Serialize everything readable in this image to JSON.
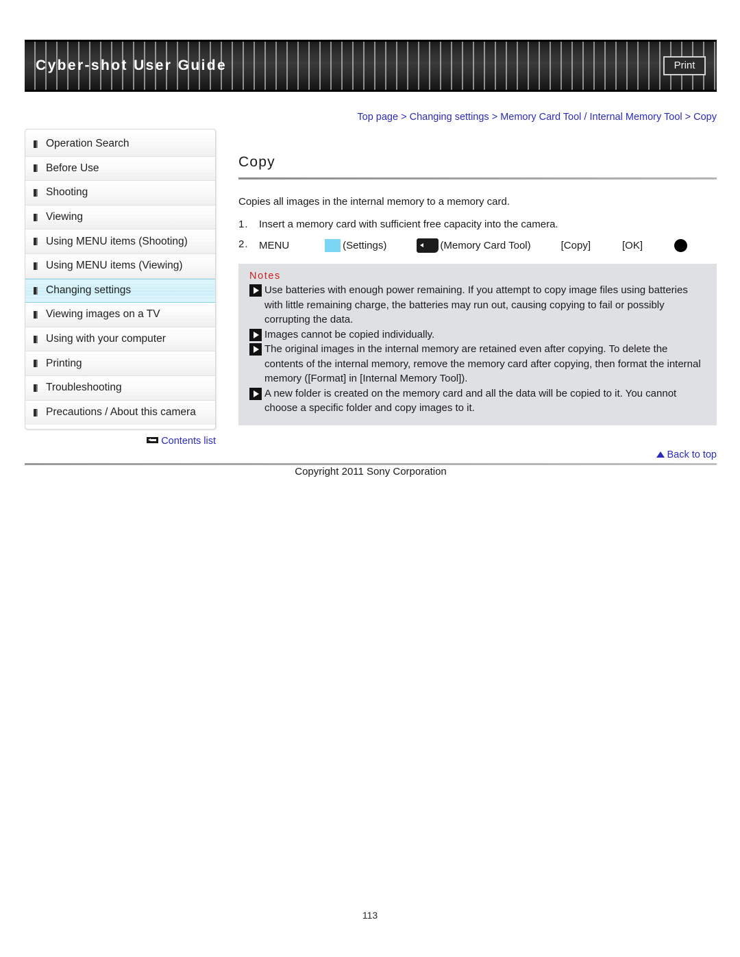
{
  "header": {
    "title": "Cyber-shot User Guide",
    "print_label": "Print"
  },
  "breadcrumb": {
    "items": [
      "Top page",
      "Changing settings",
      "Memory Card Tool / Internal Memory Tool",
      "Copy"
    ],
    "separator": ">",
    "full_text": "Top page > Changing settings > Memory Card Tool / Internal Memory Tool > Copy"
  },
  "sidebar": {
    "items": [
      {
        "label": "Operation Search",
        "active": false
      },
      {
        "label": "Before Use",
        "active": false
      },
      {
        "label": "Shooting",
        "active": false
      },
      {
        "label": "Viewing",
        "active": false
      },
      {
        "label": "Using MENU items (Shooting)",
        "active": false
      },
      {
        "label": "Using MENU items (Viewing)",
        "active": false
      },
      {
        "label": "Changing settings",
        "active": true
      },
      {
        "label": "Viewing images on a TV",
        "active": false
      },
      {
        "label": "Using with your computer",
        "active": false
      },
      {
        "label": "Printing",
        "active": false
      },
      {
        "label": "Troubleshooting",
        "active": false
      },
      {
        "label": "Precautions / About this camera",
        "active": false
      }
    ],
    "contents_list_label": "Contents list",
    "contents_list_icon": "left-arrow-box-icon",
    "active_highlight_color": "#cdeff9"
  },
  "main": {
    "title": "Copy",
    "intro": "Copies all images in the internal memory to a memory card.",
    "steps": [
      {
        "number": "1.",
        "text": "Insert a memory card with sufficient free capacity into the camera."
      }
    ],
    "menu_step": {
      "number": "2.",
      "menu_word": "MENU",
      "settings_icon": "settings-square-icon",
      "settings_icon_color": "#7ad6f2",
      "settings_label": "(Settings)",
      "memory_card_icon": "memory-card-icon",
      "memory_card_label": "(Memory Card Tool)",
      "copy_label": "[Copy]",
      "ok_label": "[OK]",
      "shutter_icon": "black-circle-icon"
    },
    "notes": {
      "heading": "Notes",
      "heading_color": "#cc2020",
      "background_color": "#dee0e4",
      "bullet_icon": "play-triangle-icon",
      "items": [
        "Use batteries with enough power remaining. If you attempt to copy image files using batteries with little remaining charge, the batteries may run out, causing copying to fail or possibly corrupting the data.",
        "Images cannot be copied individually.",
        "The original images in the internal memory are retained even after copying. To delete the contents of the internal memory, remove the memory card after copying, then format the internal memory ([Format] in [Internal Memory Tool]).",
        "A new folder is created on the memory card and all the data will be copied to it. You cannot choose a specific folder and copy images to it."
      ]
    }
  },
  "footer": {
    "back_to_top_label": "Back to top",
    "back_to_top_icon": "up-triangle-icon",
    "copyright": "Copyright 2011 Sony Corporation",
    "page_number": "113"
  }
}
